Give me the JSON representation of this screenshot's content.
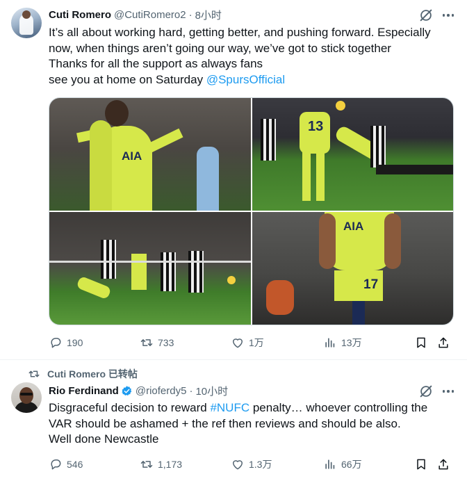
{
  "tweet1": {
    "author_name": "Cuti Romero",
    "handle": "@CutiRomero2",
    "separator": "·",
    "time": "8小时",
    "text_lines": [
      "It’s all about working hard, getting better, and pushing forward. Especially",
      "now, when things aren’t going our way, we’ve got to stick together",
      "Thanks for all the support as always fans"
    ],
    "text_last_prefix": "see you at home on Saturday ",
    "mention": "@SpursOfficial",
    "stats": {
      "replies": "190",
      "retweets": "733",
      "likes": "1万",
      "views": "13万"
    }
  },
  "retweet_label": "Cuti Romero 已转帖",
  "tweet2": {
    "author_name": "Rio Ferdinand",
    "handle": "@rioferdy5",
    "separator": "·",
    "time": "10小时",
    "text_line1_prefix": "Disgraceful decision to reward ",
    "hashtag": "#NUFC",
    "text_line1_suffix": " penalty… whoever controlling the",
    "text_lines_rest": [
      "VAR should be ashamed + the ref then reviews and should be also.",
      "Well done Newcastle"
    ],
    "stats": {
      "replies": "546",
      "retweets": "1,173",
      "likes": "1.3万",
      "views": "66万"
    }
  },
  "photo_text": {
    "sponsor": "AIA",
    "number_13": "13",
    "number_17": "17"
  },
  "colors": {
    "accent": "#1d9bf0",
    "muted": "#536471",
    "text": "#0f1419",
    "kit": "#d6e84a"
  },
  "icons": [
    "reply-icon",
    "retweet-icon",
    "like-icon",
    "views-icon",
    "bookmark-icon",
    "share-icon",
    "grok-icon",
    "more-icon",
    "verified-icon"
  ]
}
